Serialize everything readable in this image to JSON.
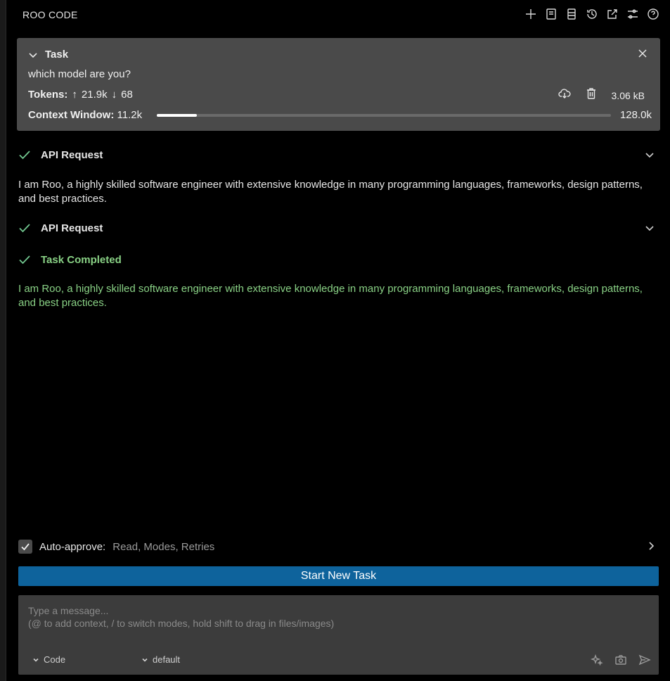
{
  "header": {
    "title": "ROO CODE",
    "icons": [
      "plus-icon",
      "prompts-icon",
      "mcp-icon",
      "history-icon",
      "popout-icon",
      "settings-icon",
      "help-icon"
    ]
  },
  "task": {
    "title": "Task",
    "question": "which model are you?",
    "tokens_label": "Tokens:",
    "tokens_up": "21.9k",
    "tokens_down": "68",
    "size": "3.06 kB",
    "context_label": "Context Window:",
    "context_used": "11.2k",
    "context_max": "128.0k",
    "context_fraction": 0.0875
  },
  "messages": [
    {
      "title": "API Request"
    },
    {
      "text": "I am Roo, a highly skilled software engineer with extensive knowledge in many programming languages, frameworks, design patterns, and best practices."
    },
    {
      "title": "API Request"
    },
    {
      "title": "Task Completed"
    },
    {
      "text": "I am Roo, a highly skilled software engineer with extensive knowledge in many programming languages, frameworks, design patterns, and best practices."
    }
  ],
  "auto_approve": {
    "label": "Auto-approve:",
    "values": "Read, Modes, Retries",
    "checked": true
  },
  "start_button": "Start New Task",
  "composer": {
    "placeholder_line1": "Type a message...",
    "placeholder_line2": "(@ to add context, / to switch modes, hold shift to drag in files/images)",
    "mode": "Code",
    "config": "default"
  },
  "colors": {
    "accent_button": "#0e639c",
    "success": "#89d185",
    "card_bg": "#4a4a4a"
  }
}
